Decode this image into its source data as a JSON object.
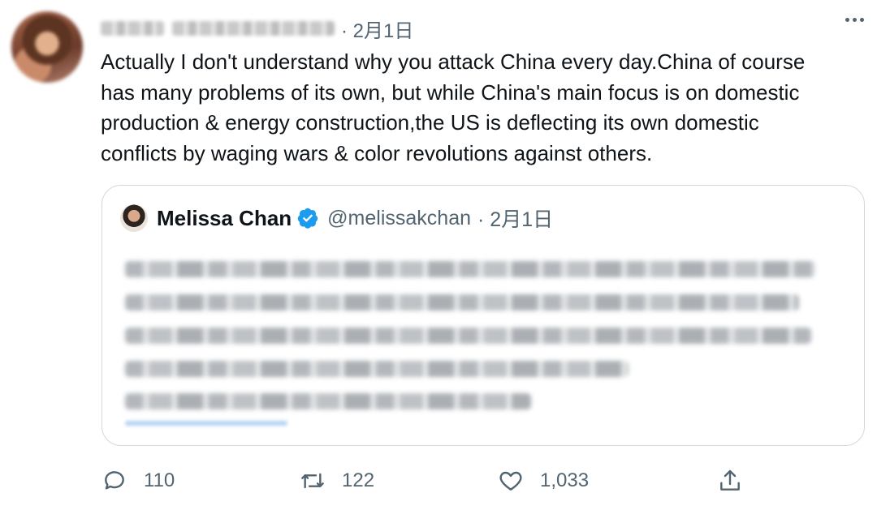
{
  "tweet": {
    "date": "· 2月1日",
    "text": "Actually I don't understand why you attack China every day.China of course\nhas many problems of its own, but while China's main focus is on domestic\nproduction & energy construction,the US is deflecting its own domestic\nconflicts by waging wars & color revolutions against others."
  },
  "quote": {
    "name": "Melissa Chan",
    "handle": "@melissakchan",
    "date": "· 2月1日"
  },
  "actions": {
    "replies": "110",
    "retweets": "122",
    "likes": "1,033"
  },
  "colors": {
    "text": "#0f1419",
    "secondary": "#536471",
    "verified": "#1d9bf0",
    "border": "#cfd9de"
  },
  "icons": [
    "more-icon",
    "verified-badge-icon",
    "reply-icon",
    "retweet-icon",
    "like-icon",
    "share-icon"
  ]
}
